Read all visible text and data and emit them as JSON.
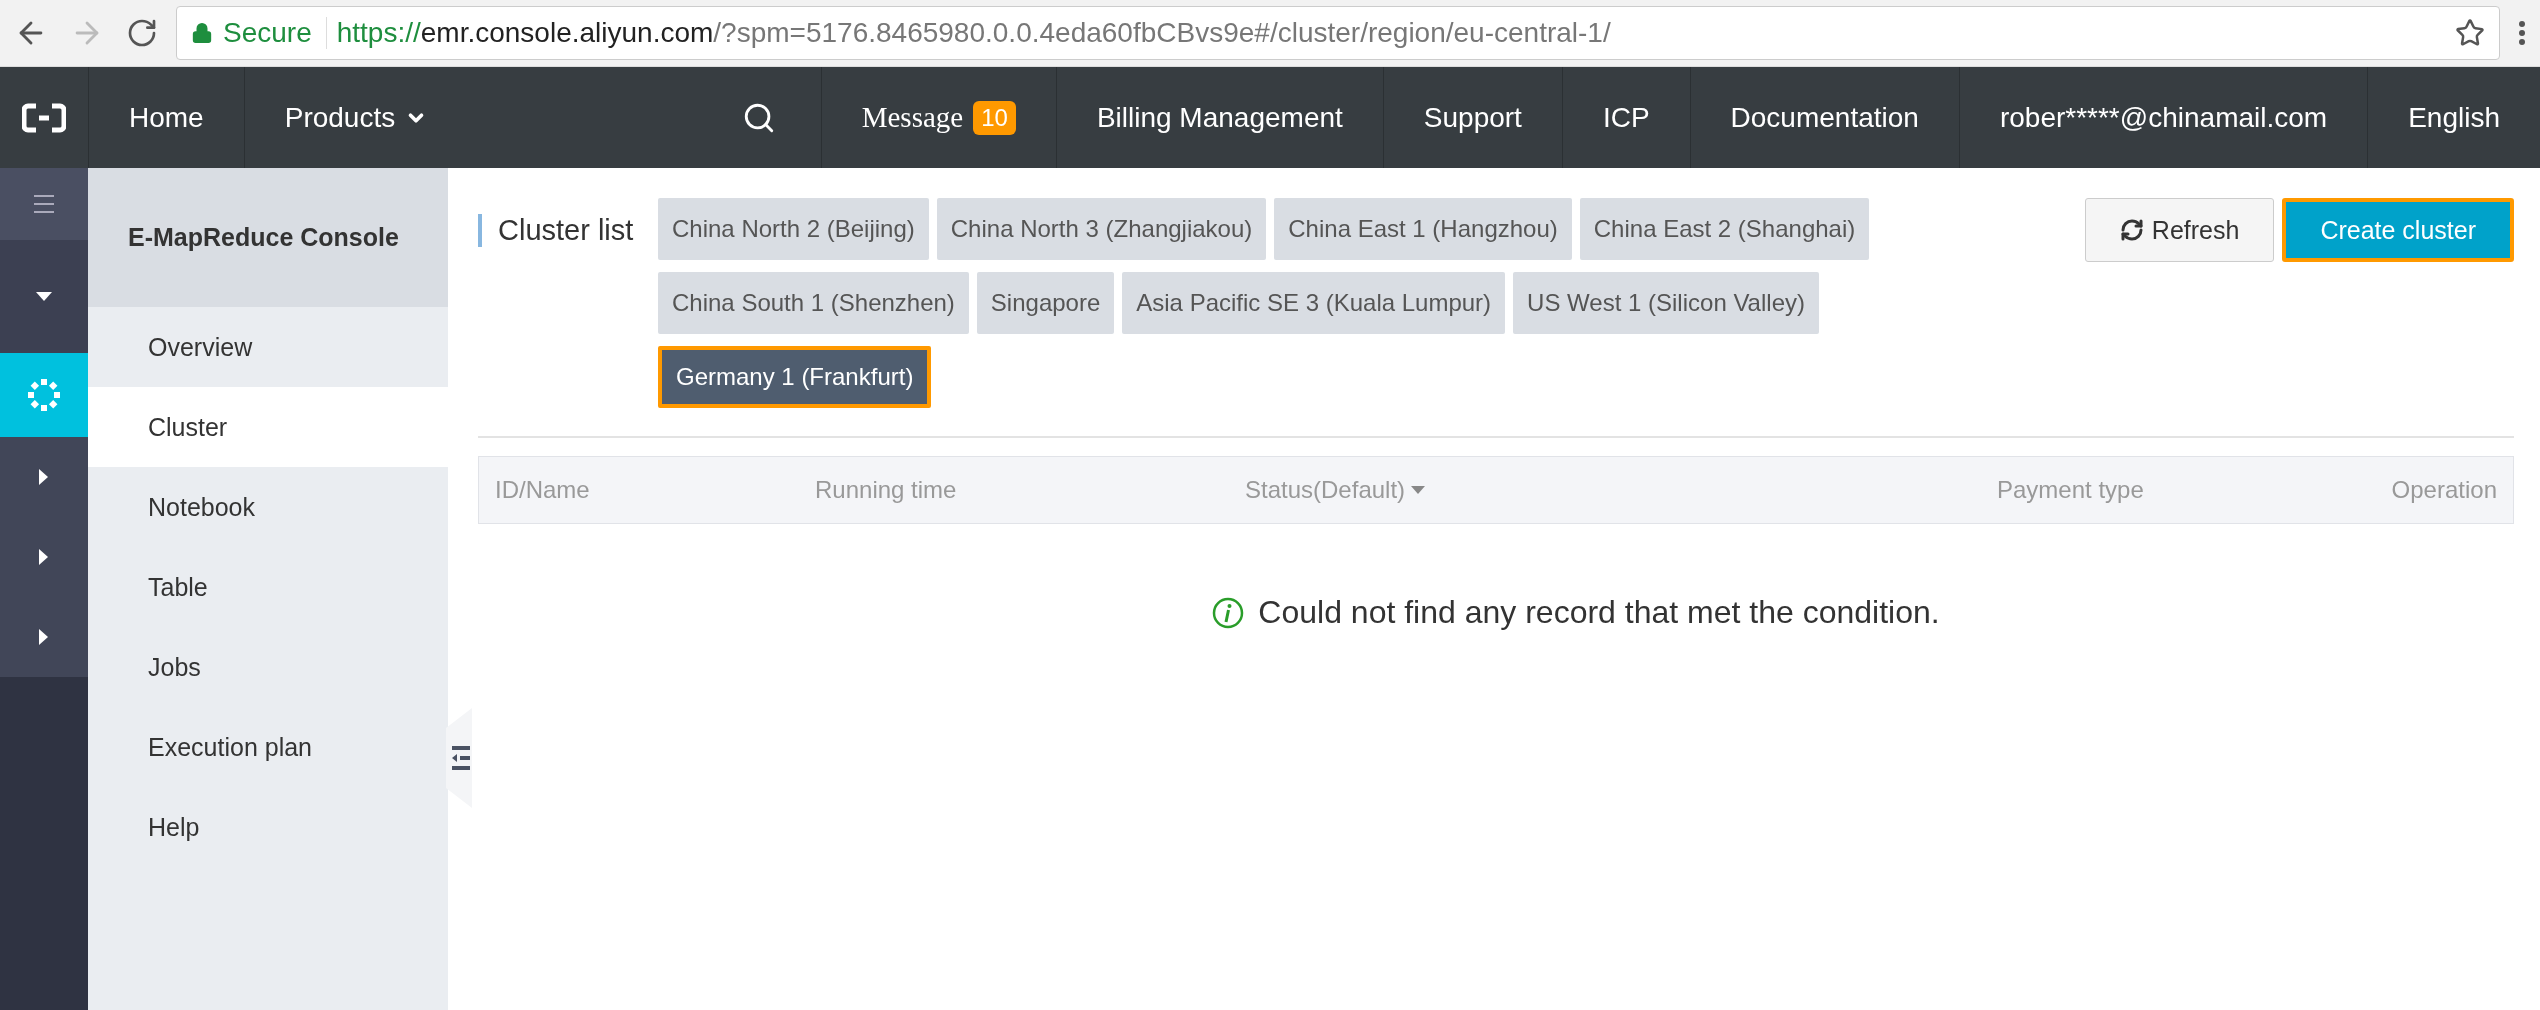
{
  "browser": {
    "secure_label": "Secure",
    "url": {
      "scheme": "https://",
      "host": "emr.console.aliyun.com",
      "path": "/?spm=5176.8465980.0.0.4eda60fbCBvs9e#/cluster/region/eu-central-1/"
    }
  },
  "top_nav": {
    "items": [
      {
        "kind": "link",
        "label": "Home"
      },
      {
        "kind": "menu",
        "label": "Products"
      },
      {
        "kind": "search"
      },
      {
        "kind": "message",
        "label": "Message",
        "badge": "10"
      },
      {
        "kind": "link",
        "label": "Billing Management"
      },
      {
        "kind": "link",
        "label": "Support"
      },
      {
        "kind": "link",
        "label": "ICP"
      },
      {
        "kind": "link",
        "label": "Documentation"
      },
      {
        "kind": "link",
        "label": "rober*****@chinamail.com"
      },
      {
        "kind": "link",
        "label": "English"
      }
    ]
  },
  "icon_rail": [
    {
      "kind": "menu",
      "selected": false
    },
    {
      "kind": "collapse",
      "selected": false
    },
    {
      "kind": "product",
      "selected": true
    },
    {
      "kind": "expand",
      "selected": false
    },
    {
      "kind": "expand",
      "selected": false
    },
    {
      "kind": "expand",
      "selected": false
    }
  ],
  "sidebar": {
    "title": "E-MapReduce Console",
    "items": [
      {
        "label": "Overview",
        "selected": false
      },
      {
        "label": "Cluster",
        "selected": true
      },
      {
        "label": "Notebook",
        "selected": false
      },
      {
        "label": "Table",
        "selected": false
      },
      {
        "label": "Jobs",
        "selected": false
      },
      {
        "label": "Execution plan",
        "selected": false
      },
      {
        "label": "Help",
        "selected": false
      }
    ]
  },
  "main": {
    "title": "Cluster list",
    "regions": [
      {
        "label": "China North 2 (Beijing)",
        "selected": false
      },
      {
        "label": "China North 3 (Zhangjiakou)",
        "selected": false
      },
      {
        "label": "China East 1 (Hangzhou)",
        "selected": false
      },
      {
        "label": "China East 2 (Shanghai)",
        "selected": false
      },
      {
        "label": "China South 1 (Shenzhen)",
        "selected": false
      },
      {
        "label": "Singapore",
        "selected": false
      },
      {
        "label": "Asia Pacific SE 3 (Kuala Lumpur)",
        "selected": false
      },
      {
        "label": "US West 1 (Silicon Valley)",
        "selected": false
      },
      {
        "label": "Germany 1 (Frankfurt)",
        "selected": true
      }
    ],
    "buttons": [
      {
        "kind": "refresh",
        "label": "Refresh"
      },
      {
        "kind": "primary",
        "label": "Create cluster"
      }
    ],
    "table": {
      "columns": [
        {
          "label": "ID/Name",
          "sortable": false
        },
        {
          "label": "Running time",
          "sortable": false
        },
        {
          "label": "Status(Default)",
          "sortable": true
        },
        {
          "label": "Payment type",
          "sortable": false
        },
        {
          "label": "Operation",
          "sortable": false
        }
      ],
      "empty_message": "Could not find any record that met the condition."
    }
  }
}
